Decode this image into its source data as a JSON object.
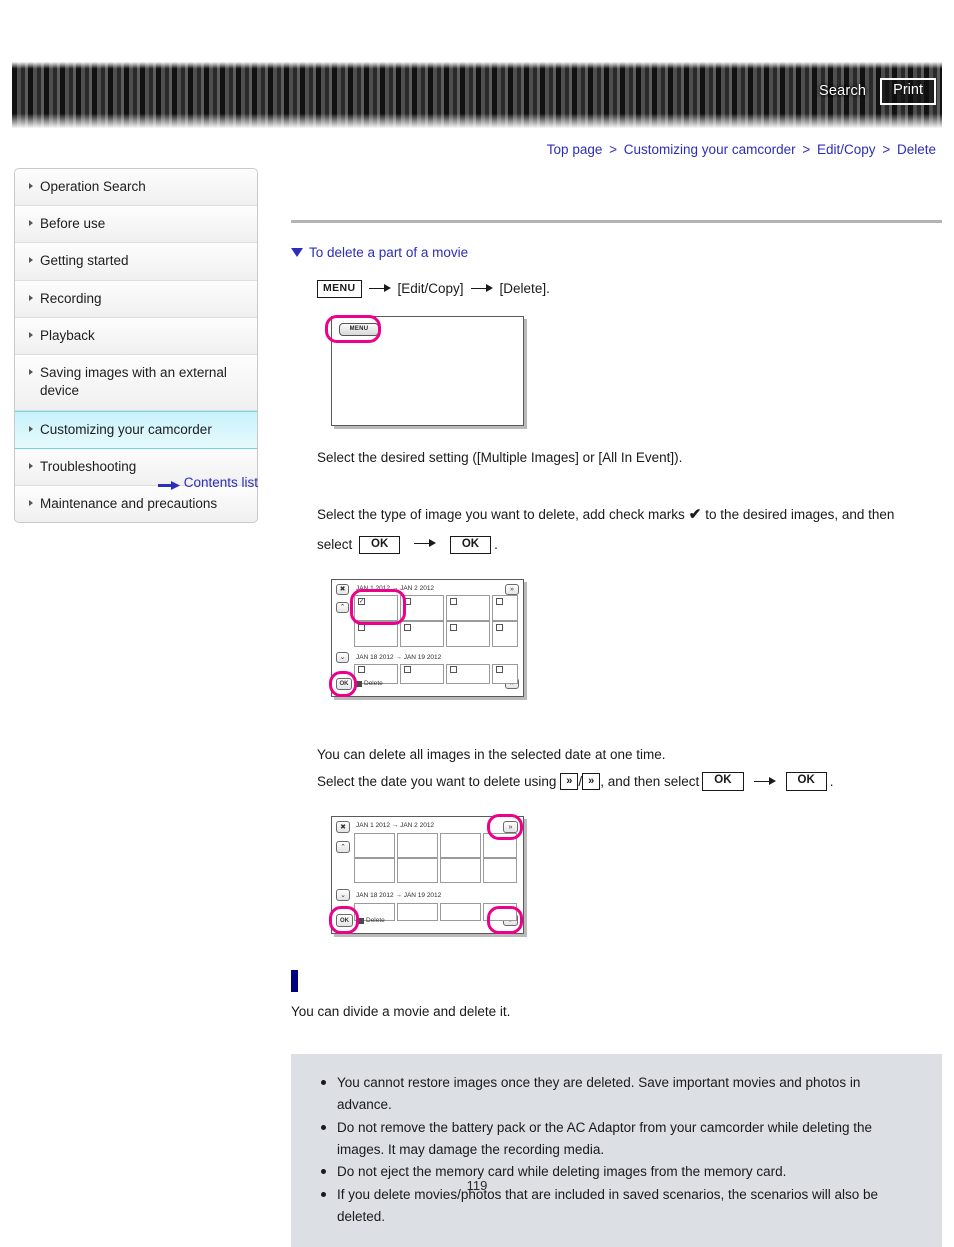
{
  "header": {
    "search_label": "Search",
    "print_label": "Print"
  },
  "breadcrumb": {
    "items": [
      "Top page",
      "Customizing your camcorder",
      "Edit/Copy",
      "Delete"
    ],
    "separator": ">"
  },
  "sidebar": {
    "items": [
      {
        "label": "Operation Search",
        "active": false
      },
      {
        "label": "Before use",
        "active": false
      },
      {
        "label": "Getting started",
        "active": false
      },
      {
        "label": "Recording",
        "active": false
      },
      {
        "label": "Playback",
        "active": false
      },
      {
        "label": "Saving images with an external device",
        "active": false
      },
      {
        "label": "Customizing your camcorder",
        "active": true
      },
      {
        "label": "Troubleshooting",
        "active": false
      },
      {
        "label": "Maintenance and precautions",
        "active": false
      }
    ],
    "contents_list_label": "Contents list"
  },
  "main": {
    "section_title": "To delete a part of a movie",
    "step1": {
      "menu_key": "MENU",
      "target1": "[Edit/Copy]",
      "target2": "[Delete]."
    },
    "step2_text": "Select the desired setting ([Multiple Images] or [All In Event]).",
    "step3": {
      "lead": "Select the type of image you want to delete, add check marks",
      "check_glyph": "✔",
      "mid": "to the desired images, and then",
      "select_word": "select",
      "ok_label": "OK",
      "period": "."
    },
    "step4": {
      "line1": "You can delete all images in the selected date at one time.",
      "line2_a": "Select the date you want to delete using",
      "up_key": "»",
      "slash": "/",
      "down_key": "»",
      "line2_b": ", and then select",
      "ok_label": "OK",
      "period": "."
    },
    "divide_note": "You can divide a movie and delete it.",
    "notes": [
      "You cannot restore images once they are deleted. Save important movies and photos in advance.",
      "Do not remove the battery pack or the AC Adaptor from your camcorder while deleting the images. It may damage the recording media.",
      "Do not eject the memory card while deleting images from the memory card.",
      "If you delete movies/photos that are included in saved scenarios, the scenarios will also be deleted."
    ]
  },
  "illustration1": {
    "menu_chip_label": "MENU"
  },
  "illustration2": {
    "close_label": "✖",
    "up_label": "⌃",
    "down_label": "⌄",
    "top_label": "»",
    "bottom_label": "»",
    "ok_label": "OK",
    "date_top": "JAN 1 2012 → JAN 2 2012",
    "date_bottom": "JAN 18 2012 → JAN 19 2012",
    "delete_label": "Delete",
    "checked_glyph": "✓"
  },
  "illustration3": {
    "close_label": "✖",
    "up_label": "⌃",
    "down_label": "⌄",
    "top_label": "»",
    "bottom_label": "»",
    "ok_label": "OK",
    "date_top": "JAN 1 2012 → JAN 2 2012",
    "date_bottom": "JAN 18 2012 → JAN 19 2012",
    "delete_label": "Delete"
  },
  "footer": {
    "page_number": "119"
  },
  "colors": {
    "link": "#2d2dbb",
    "highlight": "#ec008c",
    "active_nav": "#c8f2fb",
    "notes_bg": "#dcdfe4",
    "marker": "#000080"
  }
}
